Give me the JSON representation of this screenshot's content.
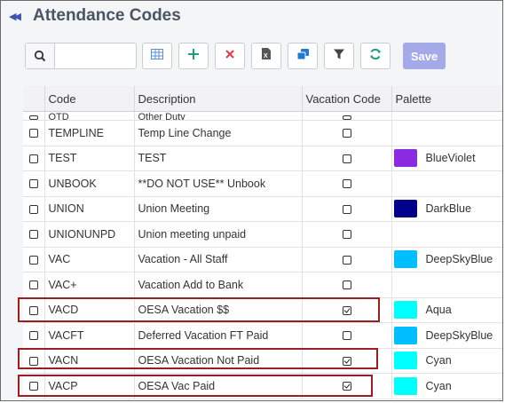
{
  "header": {
    "title": "Attendance Codes",
    "collapse_icon": "double-chevron-left-icon"
  },
  "toolbar": {
    "search_placeholder": "",
    "search_value": "",
    "buttons": [
      {
        "name": "grid-view",
        "icon": "grid-icon"
      },
      {
        "name": "add",
        "icon": "plus-icon"
      },
      {
        "name": "delete",
        "icon": "close-icon"
      },
      {
        "name": "export-excel",
        "icon": "excel-icon"
      },
      {
        "name": "copy",
        "icon": "copy-icon"
      },
      {
        "name": "filter",
        "icon": "filter-icon"
      },
      {
        "name": "refresh",
        "icon": "refresh-icon"
      }
    ],
    "save_label": "Save"
  },
  "colors": {
    "accent": "#3f51b5",
    "save": "#a4a9e8",
    "add": "#1e9e74",
    "delete": "#e53946",
    "highlight": "#a01c23"
  },
  "table": {
    "columns": {
      "code": "Code",
      "description": "Description",
      "vacation_code": "Vacation Code",
      "palette": "Palette"
    },
    "partial_row": {
      "code": "OTD",
      "description": "Other Duty"
    },
    "rows": [
      {
        "code": "TEMPLINE",
        "description": "Temp Line Change",
        "vacation": false,
        "palette": "",
        "color": ""
      },
      {
        "code": "TEST",
        "description": "TEST",
        "vacation": false,
        "palette": "BlueViolet",
        "color": "#8a2be2"
      },
      {
        "code": "UNBOOK",
        "description": "**DO NOT USE** Unbook",
        "vacation": false,
        "palette": "",
        "color": ""
      },
      {
        "code": "UNION",
        "description": "Union Meeting",
        "vacation": false,
        "palette": "DarkBlue",
        "color": "#00008b"
      },
      {
        "code": "UNIONUNPD",
        "description": "Union meeting unpaid",
        "vacation": false,
        "palette": "",
        "color": ""
      },
      {
        "code": "VAC",
        "description": "Vacation - All Staff",
        "vacation": false,
        "palette": "DeepSkyBlue",
        "color": "#00bfff"
      },
      {
        "code": "VAC+",
        "description": "Vacation Add to Bank",
        "vacation": false,
        "palette": "",
        "color": ""
      },
      {
        "code": "VACD",
        "description": "OESA Vacation $$",
        "vacation": true,
        "palette": "Aqua",
        "color": "#00ffff"
      },
      {
        "code": "VACFT",
        "description": "Deferred Vacation FT Paid",
        "vacation": false,
        "palette": "DeepSkyBlue",
        "color": "#00bfff"
      },
      {
        "code": "VACN",
        "description": "OESA Vacation Not Paid",
        "vacation": true,
        "palette": "Cyan",
        "color": "#00ffff"
      },
      {
        "code": "VACP",
        "description": "OESA Vac Paid",
        "vacation": true,
        "palette": "Cyan",
        "color": "#00ffff"
      }
    ]
  }
}
